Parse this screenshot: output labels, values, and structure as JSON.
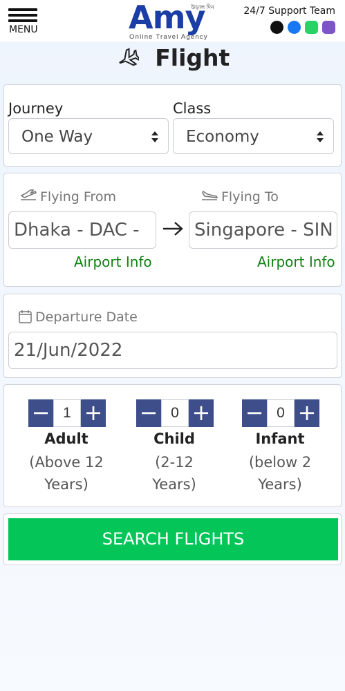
{
  "header": {
    "menu_label": "MENU",
    "brand": "Amy",
    "brand_small": "উড়াল দিন",
    "tagline": "Online Travel Agency",
    "support_title": "24/7 Support Team",
    "support_icons": [
      "phone-icon",
      "messenger-icon",
      "whatsapp-icon",
      "viber-icon"
    ]
  },
  "page": {
    "title": "Flight"
  },
  "trip": {
    "journey_label": "Journey",
    "journey_value": "One Way",
    "class_label": "Class",
    "class_value": "Economy"
  },
  "route": {
    "from_label": "Flying From",
    "from_value": "Dhaka - DAC - ",
    "to_label": "Flying To",
    "to_value": "Singapore - SIN",
    "airport_info": "Airport Info"
  },
  "date": {
    "label": "Departure Date",
    "value": "21/Jun/2022"
  },
  "passengers": [
    {
      "name": "Adult",
      "count": "1",
      "desc_line1": "(Above 12",
      "desc_line2": "Years)"
    },
    {
      "name": "Child",
      "count": "0",
      "desc_line1": "(2-12",
      "desc_line2": "Years)"
    },
    {
      "name": "Infant",
      "count": "0",
      "desc_line1": "(below 2",
      "desc_line2": "Years)"
    }
  ],
  "stepper": {
    "minus": "−",
    "plus": "+"
  },
  "search_button": "SEARCH FLIGHTS",
  "colors": {
    "brand": "#1b3ea6",
    "stepper": "#3d4e8a",
    "search": "#04c658",
    "link": "#118014"
  }
}
